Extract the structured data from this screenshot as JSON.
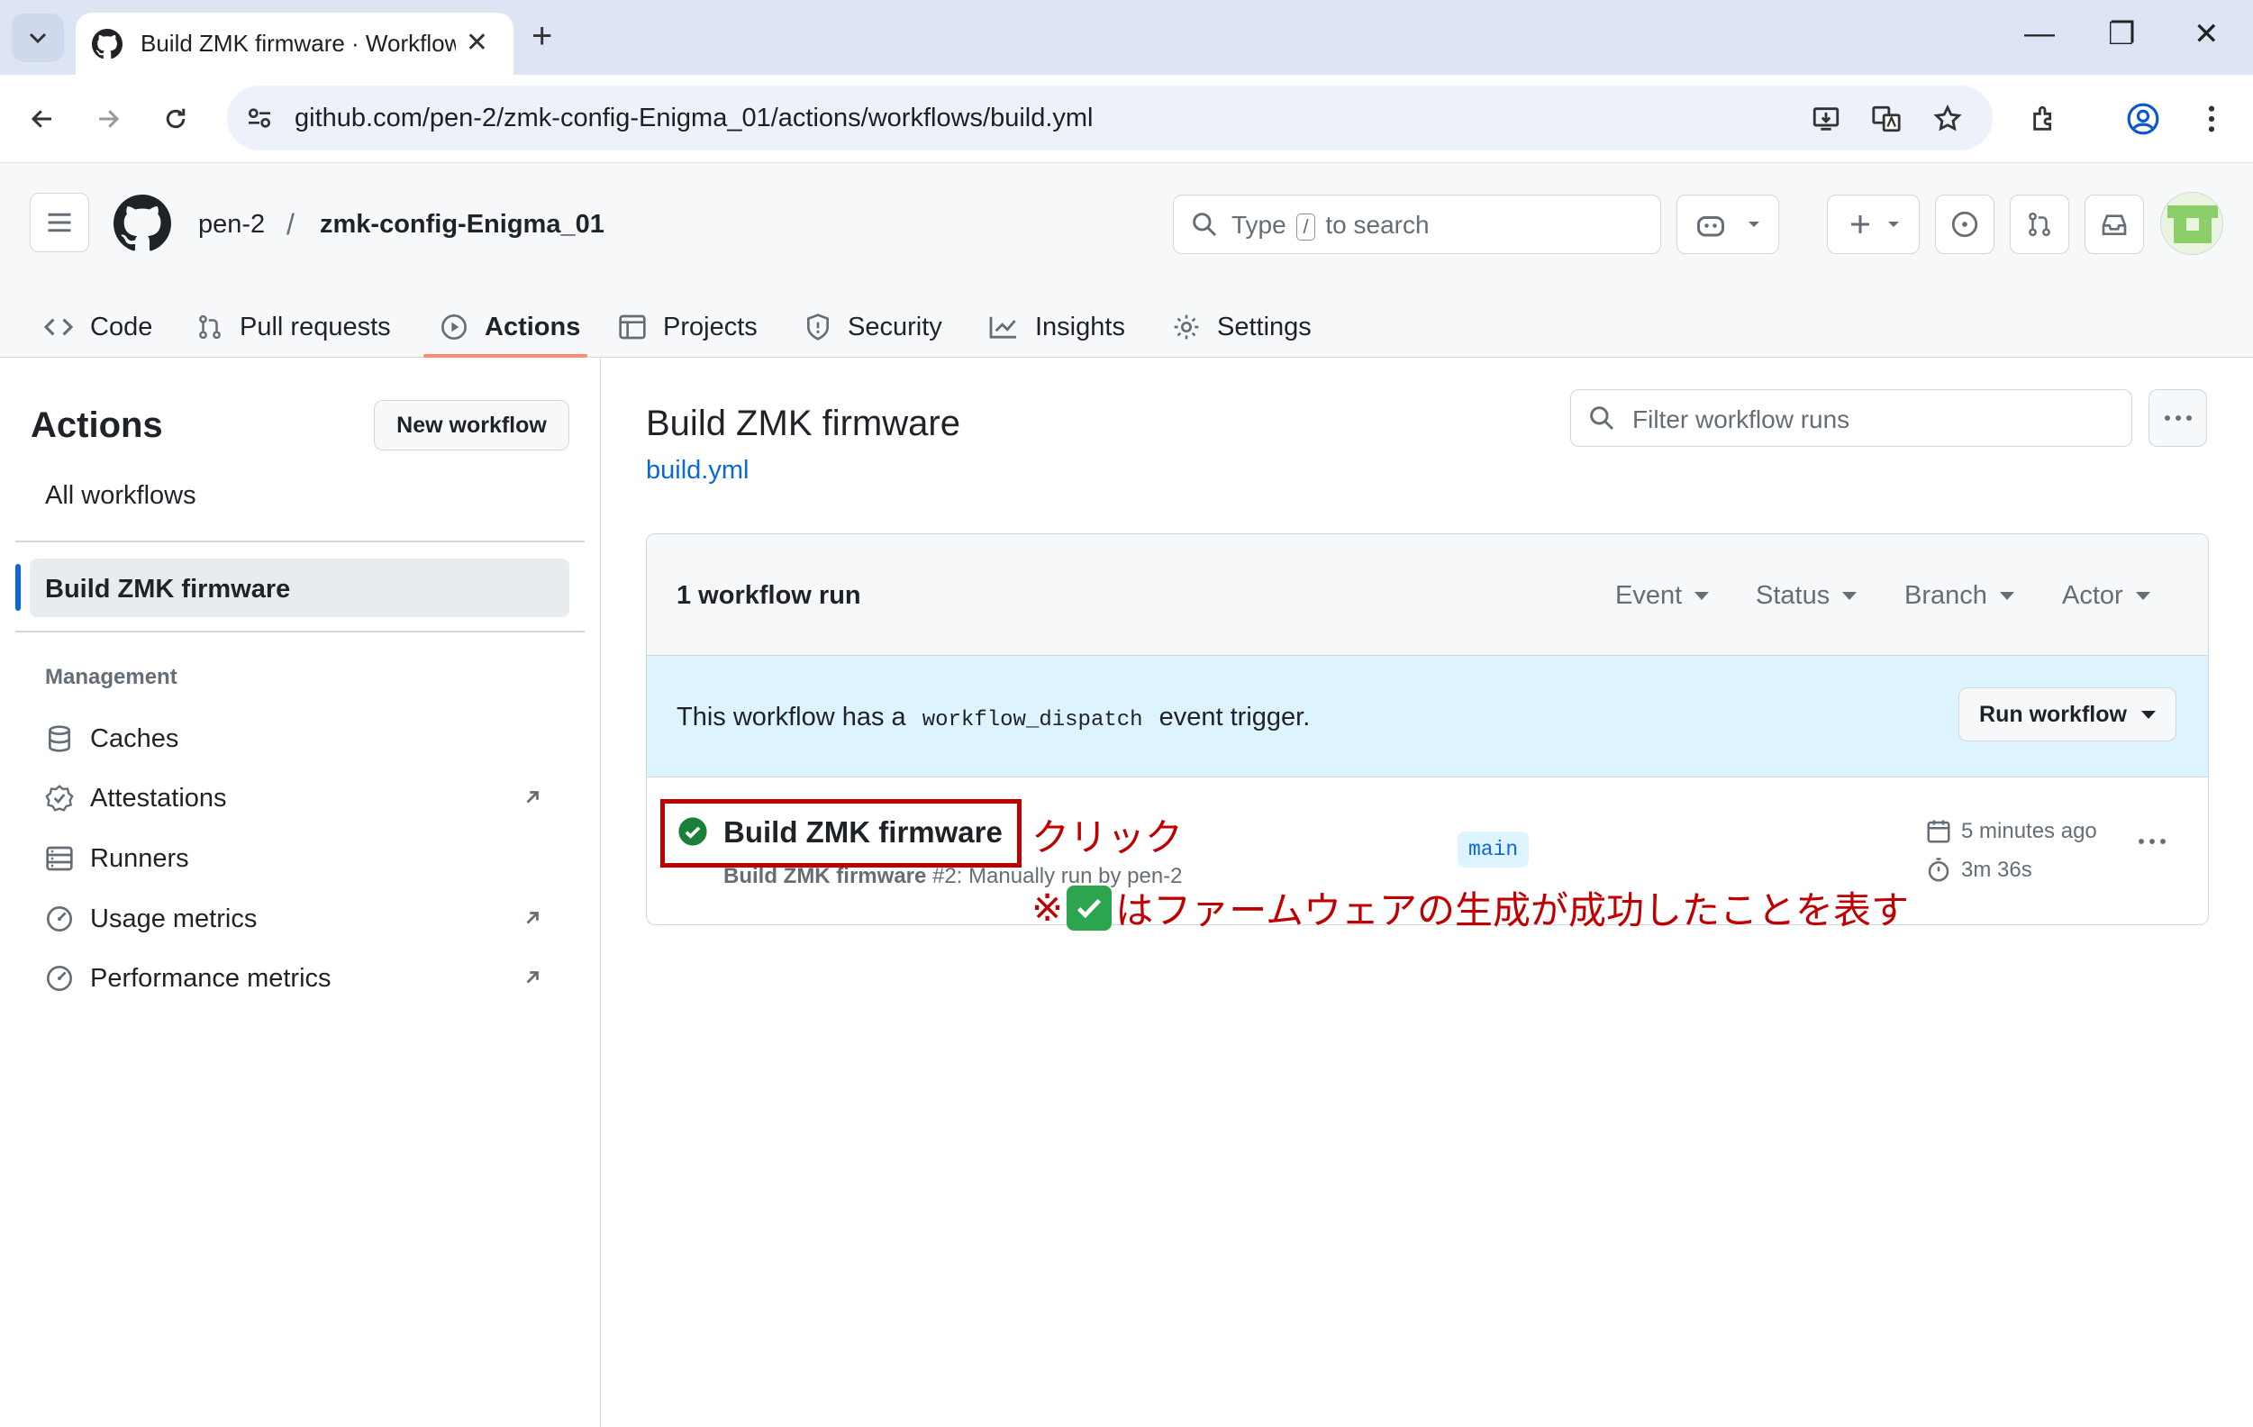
{
  "browser": {
    "tab_title": "Build ZMK firmware · Workflow",
    "url": "github.com/pen-2/zmk-config-Enigma_01/actions/workflows/build.yml"
  },
  "header": {
    "owner": "pen-2",
    "separator": "/",
    "repo": "zmk-config-Enigma_01",
    "search_prefix": "Type",
    "search_key": "/",
    "search_suffix": "to search"
  },
  "repo_nav": {
    "items": [
      "Code",
      "Pull requests",
      "Actions",
      "Projects",
      "Security",
      "Insights",
      "Settings"
    ],
    "active": "Actions"
  },
  "sidebar": {
    "title": "Actions",
    "new_workflow": "New workflow",
    "all_workflows": "All workflows",
    "selected_workflow": "Build ZMK firmware",
    "management_label": "Management",
    "management_items": [
      "Caches",
      "Attestations",
      "Runners",
      "Usage metrics",
      "Performance metrics"
    ]
  },
  "main": {
    "title": "Build ZMK firmware",
    "file": "build.yml",
    "filter_placeholder": "Filter workflow runs",
    "run_count": "1 workflow run",
    "filters": [
      "Event",
      "Status",
      "Branch",
      "Actor"
    ],
    "dispatch_prefix": "This workflow has a",
    "dispatch_code": "workflow_dispatch",
    "dispatch_suffix": "event trigger.",
    "run_workflow": "Run workflow",
    "run": {
      "name": "Build ZMK firmware",
      "sub_bold": "Build ZMK firmware",
      "sub_rest": "#2: Manually run by pen-2",
      "branch": "main",
      "time_ago": "5 minutes ago",
      "duration": "3m 36s",
      "status": "success"
    }
  },
  "annotation": {
    "click": "クリック",
    "note_prefix": "※",
    "note_suffix": "はファームウェアの生成が成功したことを表す",
    "color": "#c00000"
  },
  "colors": {
    "accent": "#0969da",
    "success": "#1a7f37",
    "active_tab_underline": "#fd8c73"
  }
}
